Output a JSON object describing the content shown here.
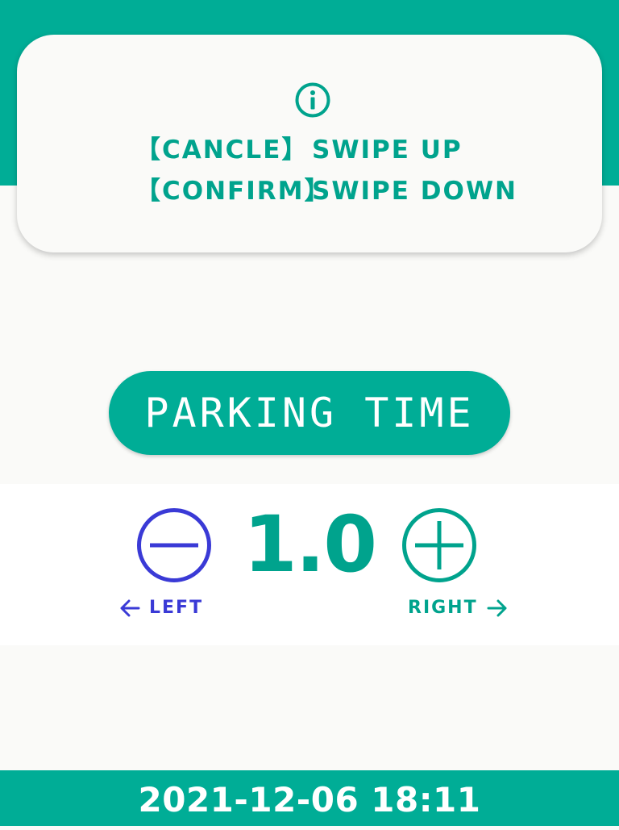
{
  "colors": {
    "accent": "#00ad96",
    "accent_text": "#00a38d",
    "left_color": "#3a3ad6",
    "background": "#fafaf8"
  },
  "info_card": {
    "icon": "info-icon",
    "instructions": [
      {
        "key": "【CANCLE】",
        "action": "SWIPE UP"
      },
      {
        "key": "【CONFIRM】",
        "action": "SWIPE DOWN"
      }
    ]
  },
  "title": "PARKING TIME",
  "control": {
    "minus_icon": "minus-circle-icon",
    "plus_icon": "plus-circle-icon",
    "value": "1.0",
    "left_hint": "LEFT",
    "right_hint": "RIGHT",
    "left_arrow_icon": "arrow-left-icon",
    "right_arrow_icon": "arrow-right-icon"
  },
  "footer": {
    "datetime": "2021-12-06 18:11"
  }
}
